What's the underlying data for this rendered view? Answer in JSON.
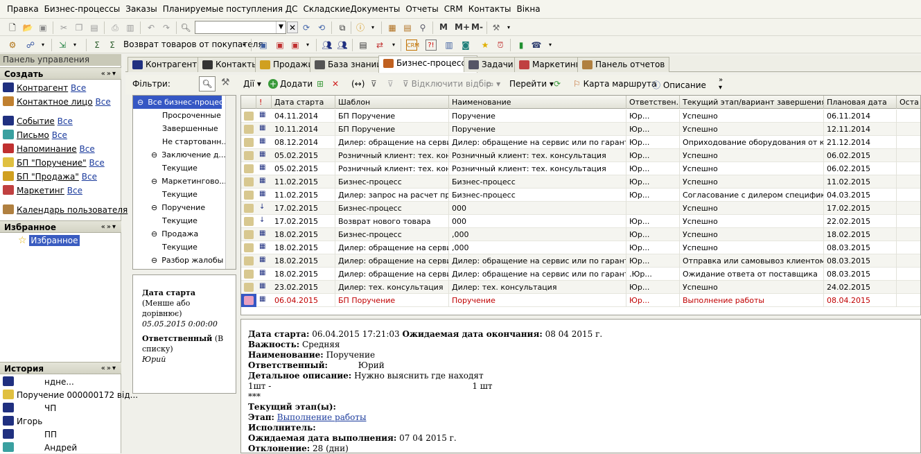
{
  "menu": [
    "Правка",
    "Бизнес-процессы",
    "Заказы",
    "Планируемые поступления ДС",
    "СкладскиеДокументы",
    "Отчеты",
    "CRM",
    "Контакты",
    "Вікна"
  ],
  "toolbar": {
    "search_value": "",
    "m1": "M",
    "m2": "M+",
    "m3": "M-",
    "return_label": "Возврат товаров от покупателя"
  },
  "left": {
    "panel_title": "Панель управления",
    "create_title": "Создать",
    "create_items": [
      {
        "label": "Контрагент",
        "all": "Все",
        "icon": "people-icon"
      },
      {
        "label": "Контактное лицо",
        "all": "Все",
        "icon": "contact-icon"
      },
      {
        "label": "Событие",
        "all": "Все",
        "icon": "people-icon"
      },
      {
        "label": "Письмо",
        "all": "Все",
        "icon": "mail-icon"
      },
      {
        "label": "Напоминание",
        "all": "Все",
        "icon": "alarm-icon"
      },
      {
        "label": "БП \"Поручение\"",
        "all": "Все",
        "icon": "doc-icon"
      },
      {
        "label": "БП \"Продажа\"",
        "all": "Все",
        "icon": "sale-icon"
      },
      {
        "label": "Маркетинг",
        "all": "Все",
        "icon": "marketing-icon"
      }
    ],
    "calendar": "Календарь пользователя",
    "fav_title": "Избранное",
    "fav_item": "Избранное",
    "hist_title": "История",
    "hist_items": [
      "ндне...",
      "Поручение 000000172 від...",
      "ЧП",
      "Игорь",
      "ПП",
      "Андрей"
    ]
  },
  "tabs": [
    "Контрагенты",
    "Контакты",
    "Продажи",
    "База знаний",
    "Бизнес-процессы",
    "Задачи",
    "Маркетинг",
    "Панель отчетов"
  ],
  "filters": {
    "label": "Фільтри:",
    "actions": "Дії",
    "add": "Додати",
    "disable_filter": "Відключити відбір",
    "go": "Перейти",
    "route_map": "Карта маршрута",
    "description": "Описание"
  },
  "tree": [
    "Все бизнес-процес...",
    "Просроченные",
    "Завершенные",
    "Не стартованн...",
    "Заключение д...",
    "Текущие",
    "Маркетингово...",
    "Текущие",
    "Поручение",
    "Текущие",
    "Продажа",
    "Текущие",
    "Разбор жалобы"
  ],
  "details": {
    "start_label": "Дата старта",
    "start_cond": "(Менше або дорівнює)",
    "start_value": "05.05.2015 0:00:00",
    "resp_label": "Ответственный",
    "resp_cond": "(В списку)",
    "resp_value": "Юрий"
  },
  "grid": {
    "columns": [
      "Дата старта",
      "Шаблон",
      "Наименование",
      "Ответствен...",
      "Текущий этап/вариант завершения",
      "Плановая дата",
      "Оста"
    ],
    "rows": [
      [
        "04.11.2014",
        "БП Поручение",
        "Поручение",
        "Юр...",
        "Успешно",
        "06.11.2014"
      ],
      [
        "10.11.2014",
        "БП Поручение",
        "Поручение",
        "Юр...",
        "Успешно",
        "12.11.2014"
      ],
      [
        "08.12.2014",
        "Дилер: обращение на серви...",
        "Дилер: обращение на сервис или по гарантии",
        "Юр...",
        "Оприходование оборудования от кли...",
        "21.12.2014"
      ],
      [
        "05.02.2015",
        "Розничный клиент: тех. конс...",
        "Розничный клиент: тех. консультация",
        "Юр...",
        "Успешно",
        "06.02.2015"
      ],
      [
        "05.02.2015",
        "Розничный клиент: тех. конс...",
        "Розничный клиент: тех. консультация",
        "Юр...",
        "Успешно",
        "06.02.2015"
      ],
      [
        "11.02.2015",
        "Бизнес-процесс",
        "Бизнес-процесс",
        "Юр...",
        "Успешно",
        "11.02.2015"
      ],
      [
        "11.02.2015",
        "Дилер: запрос на расчет пр...",
        "Бизнес-процесс",
        "Юр...",
        "Согласование с дилером специфика...",
        "04.03.2015"
      ],
      [
        "17.02.2015",
        "Бизнес-процесс",
        "000",
        "",
        "Успешно",
        "17.02.2015"
      ],
      [
        "17.02.2015",
        "Возврат нового товара",
        "000",
        "Юр...",
        "Успешно",
        "22.02.2015"
      ],
      [
        "18.02.2015",
        "Бизнес-процесс",
        ",000",
        "Юр...",
        "Успешно",
        "18.02.2015"
      ],
      [
        "18.02.2015",
        "Дилер: обращение на серви...",
        ",000",
        "Юр...",
        "Успешно",
        "08.03.2015"
      ],
      [
        "18.02.2015",
        "Дилер: обращение на серви...",
        "Дилер: обращение на сервис или по гарантии",
        "Юр...",
        "Отправка или самовывоз клиентом",
        "08.03.2015"
      ],
      [
        "18.02.2015",
        "Дилер: обращение на серви...",
        "Дилер: обращение на сервис или по гарантии",
        ".Юр...",
        "Ожидание ответа от поставщика",
        "08.03.2015"
      ],
      [
        "23.02.2015",
        "Дилер: тех. консультация",
        "Дилер: тех. консультация",
        "Юр...",
        "Успешно",
        "24.02.2015"
      ],
      [
        "06.04.2015",
        "БП Поручение",
        "Поручение",
        "Юр...",
        "Выполнение работы",
        "08.04.2015"
      ]
    ]
  },
  "info": {
    "start_label": "Дата старта:",
    "start_value": "06.04.2015 17:21:03",
    "end_label": "Ожидаемая дата окончания:",
    "end_value": "08 04 2015 г.",
    "importance_label": "Важность:",
    "importance_value": "Средняя",
    "name_label": "Наименование:",
    "name_value": "Поручение",
    "resp_label": "Ответственный:",
    "resp_value": "Юрий",
    "desc_label": "Детальное описание:",
    "desc_value": "Нужно выяснить где находят",
    "desc_line2a": "1шт -",
    "desc_line2b": "1 шт",
    "stars": "***",
    "stage_title": "Текущий этап(ы):",
    "stage_label": "Этап:",
    "stage_link": "Выполнение работы",
    "exec_label": "Исполнитель:",
    "exp_label": "Ожидаемая дата выполнения:",
    "exp_value": "07 04 2015 г.",
    "dev_label": "Отклонение:",
    "dev_value": "28 (дни)"
  }
}
